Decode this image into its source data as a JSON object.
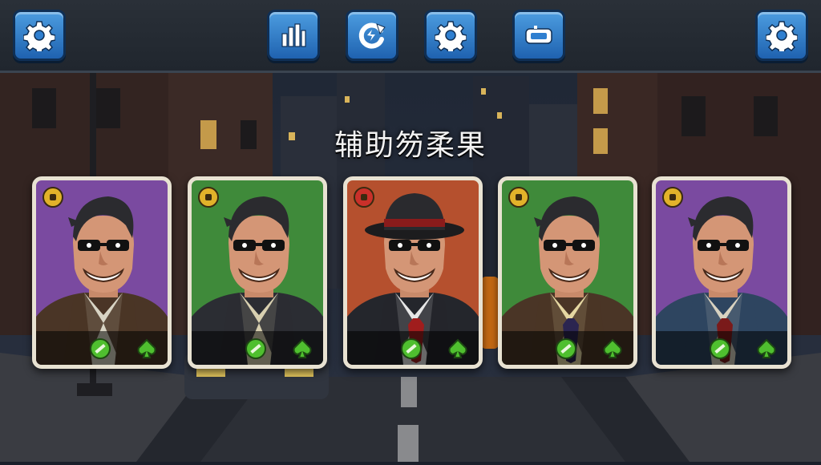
{
  "screen": {
    "title": "辅助笏柔果"
  },
  "topbar": {
    "left_button_icon": "gear-icon",
    "center_buttons": [
      "bar-chart-icon",
      "refresh-icon",
      "gear-icon",
      "console-icon"
    ],
    "right_button_icon": "gear-icon",
    "accent": "#2f7fd0"
  },
  "cards": [
    {
      "background": "#7a4aa0",
      "badge_icon": "coin-icon",
      "badge_color": "#e2b22a",
      "hat": false,
      "jacket": "#4a3526",
      "shirt": "#d8d4c4",
      "tie": "",
      "abilities": [
        "green-slash-icon",
        "green-spade-icon"
      ]
    },
    {
      "background": "#3f8a3a",
      "badge_icon": "coin-icon",
      "badge_color": "#e2b22a",
      "hat": false,
      "jacket": "#2b2d33",
      "shirt": "#d8d0b0",
      "tie": "",
      "abilities": [
        "green-slash-icon",
        "green-spade-icon"
      ]
    },
    {
      "background": "#b5502e",
      "badge_icon": "dynamite-icon",
      "badge_color": "#c9302a",
      "hat": true,
      "jacket": "#24262c",
      "shirt": "#e6e6e6",
      "tie": "#a01d1d",
      "abilities": [
        "green-slash-icon",
        "green-spade-icon"
      ]
    },
    {
      "background": "#3f8a3a",
      "badge_icon": "coin-icon",
      "badge_color": "#e2b22a",
      "hat": false,
      "jacket": "#4a3526",
      "shirt": "#e5d7a2",
      "tie": "#2b2550",
      "abilities": [
        "green-slash-icon",
        "green-spade-icon"
      ]
    },
    {
      "background": "#7a4aa0",
      "badge_icon": "coin-icon",
      "badge_color": "#e2b22a",
      "hat": false,
      "jacket": "#2e4560",
      "shirt": "#d8d2c0",
      "tie": "#7a1a1a",
      "abilities": [
        "green-slash-icon",
        "green-spade-icon"
      ]
    }
  ]
}
